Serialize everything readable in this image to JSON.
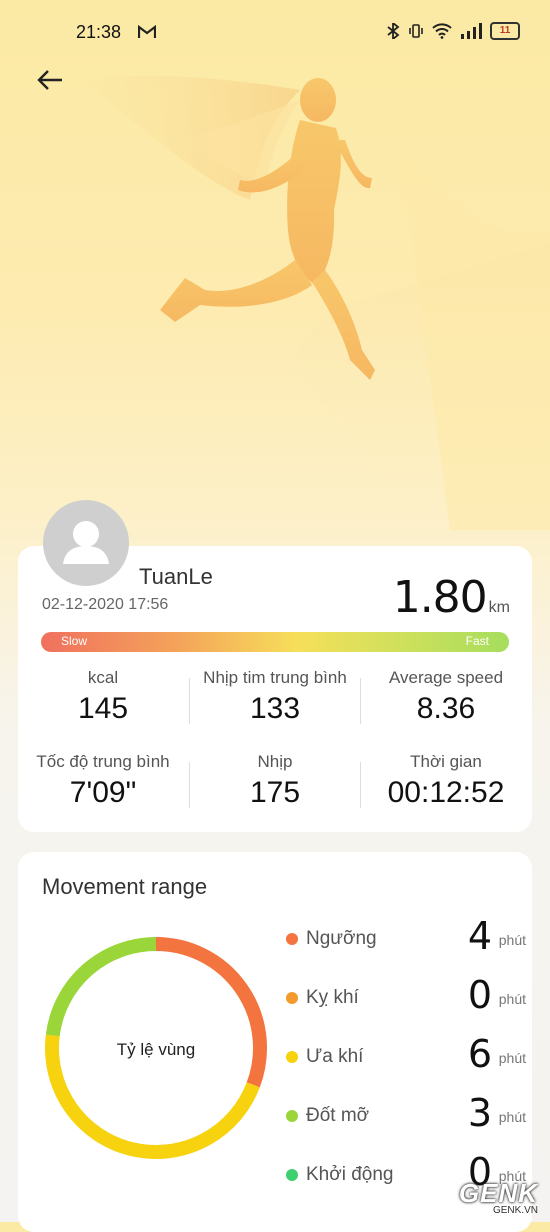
{
  "status_bar": {
    "time": "21:38",
    "battery": "11"
  },
  "user": {
    "name": "TuanLe",
    "datetime": "02-12-2020 17:56"
  },
  "distance": {
    "value": "1.80",
    "unit": "km"
  },
  "pace_bar": {
    "slow_label": "Slow",
    "fast_label": "Fast"
  },
  "stats": [
    {
      "label": "kcal",
      "value": "145"
    },
    {
      "label": "Nhịp tim trung bình",
      "value": "133"
    },
    {
      "label": "Average speed",
      "value": "8.36"
    },
    {
      "label": "Tốc độ trung bình",
      "value": "7'09\""
    },
    {
      "label": "Nhịp",
      "value": "175"
    },
    {
      "label": "Thời gian",
      "value": "00:12:52"
    }
  ],
  "movement": {
    "title": "Movement range",
    "ring_label": "Tỷ lệ vùng",
    "zones": [
      {
        "name": "Ngưỡng",
        "minutes": "4",
        "unit": "phút",
        "color": "#f4743f"
      },
      {
        "name": "Kỵ khí",
        "minutes": "0",
        "unit": "phút",
        "color": "#f59a2c"
      },
      {
        "name": "Ưa khí",
        "minutes": "6",
        "unit": "phút",
        "color": "#f7d20e"
      },
      {
        "name": "Đốt mỡ",
        "minutes": "3",
        "unit": "phút",
        "color": "#9ad63a"
      },
      {
        "name": "Khởi động",
        "minutes": "0",
        "unit": "phút",
        "color": "#3ecf6e"
      }
    ]
  },
  "watermark": {
    "brand": "GENK",
    "site": "GENK.VN"
  }
}
